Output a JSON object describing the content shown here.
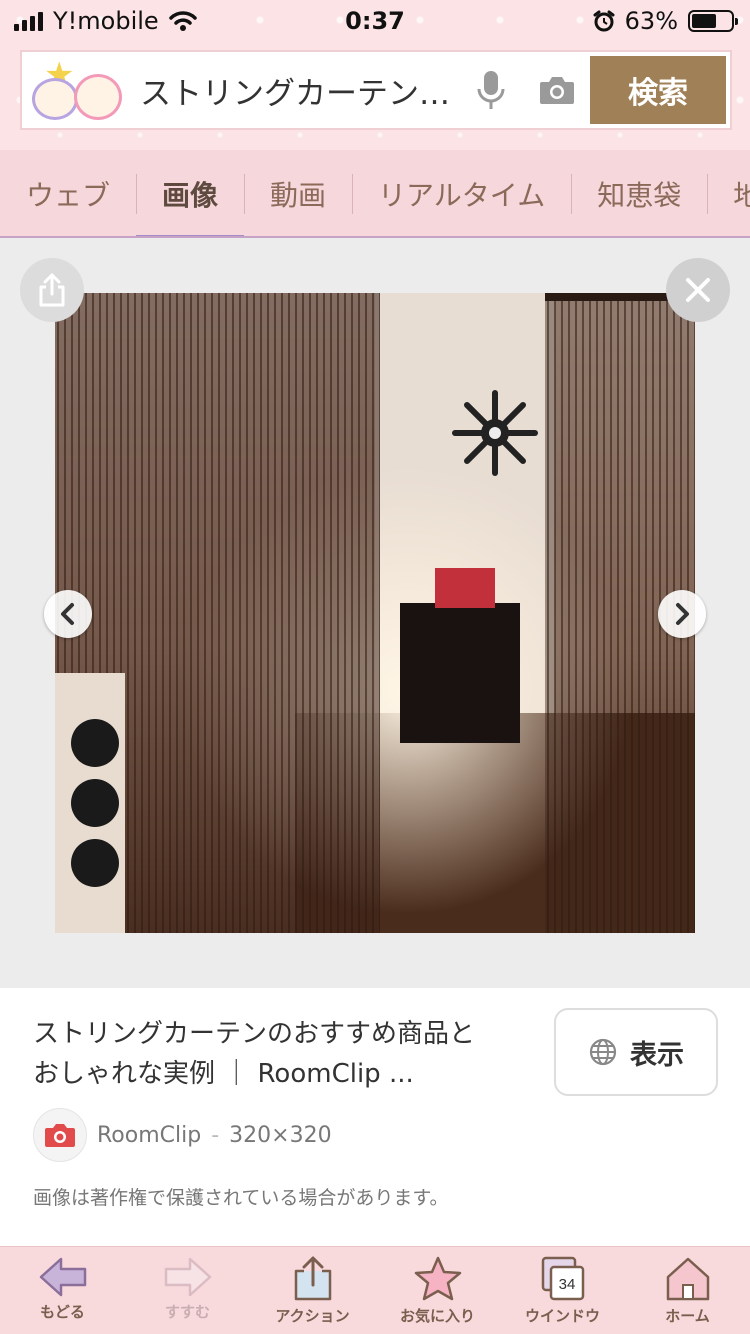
{
  "status_bar": {
    "carrier": "Y!mobile",
    "time": "0:37",
    "battery": "63%",
    "battery_level": 0.63
  },
  "search": {
    "query": "ストリングカーテン…",
    "button_label": "検索"
  },
  "tabs": [
    {
      "label": "ウェブ",
      "active": false
    },
    {
      "label": "画像",
      "active": true
    },
    {
      "label": "動画",
      "active": false
    },
    {
      "label": "リアルタイム",
      "active": false
    },
    {
      "label": "知恵袋",
      "active": false
    },
    {
      "label": "地図",
      "active": false
    }
  ],
  "result": {
    "title_line1": "ストリングカーテンのおすすめ商品と",
    "title_line2": "おしゃれな実例 ｜ RoomClip ...",
    "show_button": "表示",
    "source_name": "RoomClip",
    "separator": "-",
    "dimensions": "320×320",
    "notice": "画像は著作権で保護されている場合があります。"
  },
  "bottom_nav": [
    {
      "label": "もどる",
      "icon": "back-arrow-icon",
      "enabled": true
    },
    {
      "label": "すすむ",
      "icon": "forward-arrow-icon",
      "enabled": false
    },
    {
      "label": "アクション",
      "icon": "share-action-icon",
      "enabled": true
    },
    {
      "label": "お気に入り",
      "icon": "star-icon",
      "enabled": true
    },
    {
      "label": "ウインドウ",
      "icon": "windows-icon",
      "enabled": true,
      "count": "34"
    },
    {
      "label": "ホーム",
      "icon": "home-icon",
      "enabled": true
    }
  ]
}
